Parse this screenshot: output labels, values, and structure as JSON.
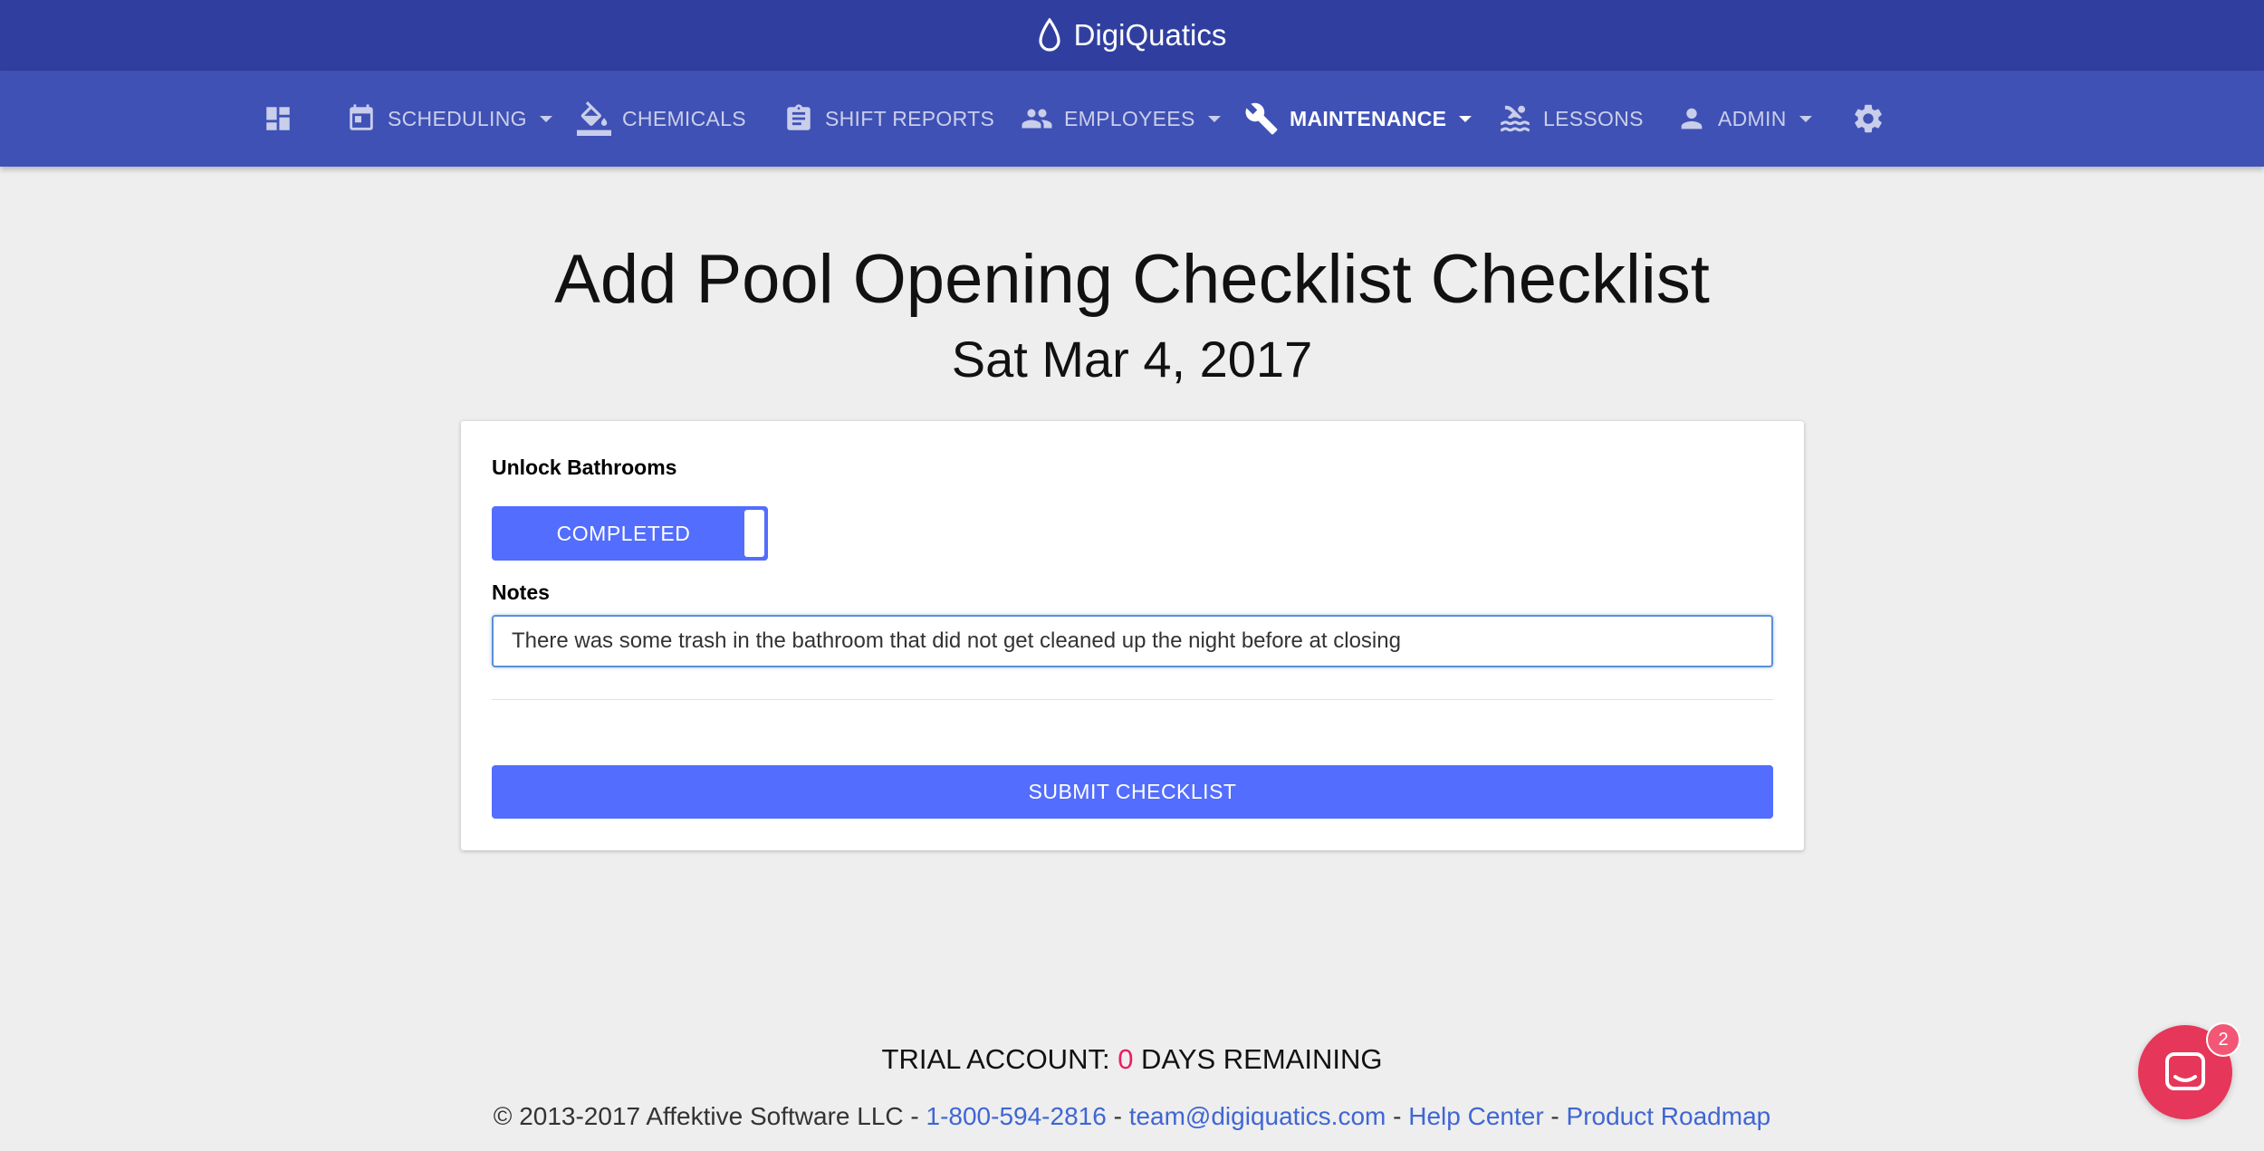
{
  "app": {
    "brand_name": "DigiQuatics"
  },
  "nav": {
    "items": [
      {
        "label": "",
        "icon": "dashboard-icon"
      },
      {
        "label": "SCHEDULING",
        "icon": "calendar-icon",
        "dropdown": true
      },
      {
        "label": "CHEMICALS",
        "icon": "paint-bucket-icon"
      },
      {
        "label": "SHIFT REPORTS",
        "icon": "clipboard-icon"
      },
      {
        "label": "EMPLOYEES",
        "icon": "people-icon",
        "dropdown": true
      },
      {
        "label": "MAINTENANCE",
        "icon": "wrench-icon",
        "dropdown": true,
        "active": true
      },
      {
        "label": "LESSONS",
        "icon": "pool-icon"
      },
      {
        "label": "ADMIN",
        "icon": "person-icon",
        "dropdown": true
      },
      {
        "label": "",
        "icon": "gear-icon"
      }
    ]
  },
  "page": {
    "title": "Add Pool Opening Checklist Checklist",
    "date": "Sat Mar 4, 2017"
  },
  "form": {
    "task_label": "Unlock Bathrooms",
    "toggle_label": "COMPLETED",
    "notes_label": "Notes",
    "notes_value": "There was some trash in the bathroom that did not get cleaned up the night before at closing",
    "submit_label": "SUBMIT CHECKLIST"
  },
  "footer": {
    "trial_prefix": "TRIAL ACCOUNT: ",
    "trial_days": "0",
    "trial_suffix": " DAYS REMAINING",
    "copyright": "© 2013-2017 Affektive Software LLC - ",
    "phone": "1-800-594-2816",
    "sep": " - ",
    "email": "team@digiquatics.com",
    "help": "Help Center",
    "roadmap": "Product Roadmap"
  },
  "chat": {
    "badge_count": "2"
  },
  "colors": {
    "brand_bar": "#303f9f",
    "nav_bar": "#3f51b5",
    "accent": "#536dfe",
    "link": "#3f66d4",
    "alert": "#e91e63",
    "chat": "#e6365a"
  }
}
